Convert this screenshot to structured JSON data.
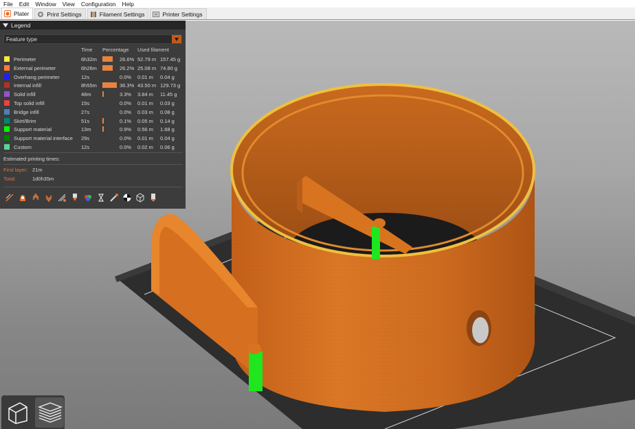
{
  "menu": [
    "File",
    "Edit",
    "Window",
    "View",
    "Configuration",
    "Help"
  ],
  "tabs": [
    {
      "label": "Plater",
      "icon": "plater-icon"
    },
    {
      "label": "Print Settings",
      "icon": "gear-icon"
    },
    {
      "label": "Filament Settings",
      "icon": "spool-icon"
    },
    {
      "label": "Printer Settings",
      "icon": "printer-icon"
    }
  ],
  "legend": {
    "title": "Legend",
    "view_type": "Feature type",
    "columns": {
      "time": "Time",
      "percentage": "Percentage",
      "used": "Used filament"
    },
    "rows": [
      {
        "name": "Perimeter",
        "color": "#ffe64d",
        "time": "6h32m",
        "pct": "26.6%",
        "pct_value": 26.6,
        "len": "52.79 m",
        "weight": "157.45 g"
      },
      {
        "name": "External perimeter",
        "color": "#ff7d38",
        "time": "6h26m",
        "pct": "26.2%",
        "pct_value": 26.2,
        "len": "25.08 m",
        "weight": "74.80 g"
      },
      {
        "name": "Overhang perimeter",
        "color": "#1f1fff",
        "time": "12s",
        "pct": "0.0%",
        "pct_value": 0.0,
        "len": "0.01 m",
        "weight": "0.04 g"
      },
      {
        "name": "Internal infill",
        "color": "#b03029",
        "time": "8h55m",
        "pct": "36.3%",
        "pct_value": 36.3,
        "len": "43.50 m",
        "weight": "129.73 g"
      },
      {
        "name": "Solid infill",
        "color": "#9654cc",
        "time": "48m",
        "pct": "3.3%",
        "pct_value": 3.3,
        "len": "3.84 m",
        "weight": "11.45 g"
      },
      {
        "name": "Top solid infill",
        "color": "#f04040",
        "time": "15s",
        "pct": "0.0%",
        "pct_value": 0.0,
        "len": "0.01 m",
        "weight": "0.03 g"
      },
      {
        "name": "Bridge infill",
        "color": "#4d80ba",
        "time": "27s",
        "pct": "0.0%",
        "pct_value": 0.0,
        "len": "0.03 m",
        "weight": "0.08 g"
      },
      {
        "name": "Skirt/Brim",
        "color": "#00876e",
        "time": "51s",
        "pct": "0.1%",
        "pct_value": 0.1,
        "len": "0.05 m",
        "weight": "0.14 g"
      },
      {
        "name": "Support material",
        "color": "#00ff00",
        "time": "13m",
        "pct": "0.9%",
        "pct_value": 0.9,
        "len": "0.56 m",
        "weight": "1.68 g"
      },
      {
        "name": "Support material interface",
        "color": "#008000",
        "time": "29s",
        "pct": "0.0%",
        "pct_value": 0.0,
        "len": "0.01 m",
        "weight": "0.04 g"
      },
      {
        "name": "Custom",
        "color": "#5ed194",
        "time": "12s",
        "pct": "0.0%",
        "pct_value": 0.0,
        "len": "0.02 m",
        "weight": "0.06 g"
      }
    ],
    "estimated": {
      "title": "Estimated printing times:",
      "first_layer_label": "First layer:",
      "first_layer_value": "21m",
      "total_label": "Total:",
      "total_value": "1d0h35m"
    },
    "toolbar_icons": [
      "travel-icon",
      "wipe-icon",
      "retractions-icon",
      "deretractions-icon",
      "seams-icon",
      "tool-changes-icon",
      "color-changes-icon",
      "pause-icon",
      "custom-gcode-icon",
      "center-of-gravity-icon",
      "shells-icon",
      "tool-marker-icon"
    ]
  },
  "view_buttons": [
    {
      "name": "3d-view-button",
      "icon": "cube-icon",
      "active": false
    },
    {
      "name": "preview-button",
      "icon": "layers-icon",
      "active": true
    }
  ],
  "colors": {
    "accent": "#ed6b21",
    "model": "#d9711f",
    "support": "#1fe61f"
  }
}
